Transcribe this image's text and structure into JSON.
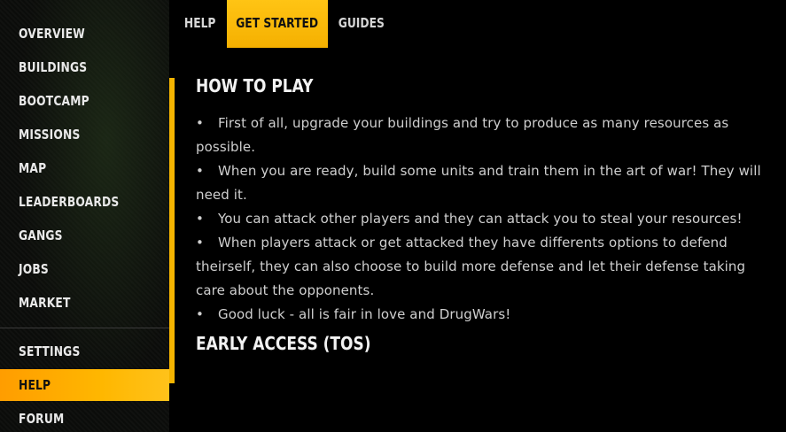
{
  "sidebar": {
    "items": [
      {
        "label": "OVERVIEW"
      },
      {
        "label": "BUILDINGS"
      },
      {
        "label": "BOOTCAMP"
      },
      {
        "label": "MISSIONS"
      },
      {
        "label": "MAP"
      },
      {
        "label": "LEADERBOARDS"
      },
      {
        "label": "GANGS"
      },
      {
        "label": "JOBS"
      },
      {
        "label": "MARKET"
      },
      {
        "label": "SETTINGS"
      },
      {
        "label": "HELP"
      },
      {
        "label": "FORUM"
      }
    ],
    "active_item": "HELP"
  },
  "tabs": {
    "items": [
      {
        "label": "HELP"
      },
      {
        "label": "GET STARTED"
      },
      {
        "label": "GUIDES"
      }
    ],
    "active_tab": "GET STARTED"
  },
  "content": {
    "how_to_play": {
      "title": "HOW TO PLAY",
      "bullets": [
        "First of all, upgrade your buildings and try to produce as many resources as possible.",
        "When you are ready, build some units and train them in the art of war! They will need it.",
        "You can attack other players and they can attack you to steal your resources!",
        "When players attack or get attacked they have differents options to defend theirself, they can also choose to build more defense and let their defense taking care about the opponents.",
        "Good luck - all is fair in love and DrugWars!"
      ]
    },
    "early_access": {
      "title": "EARLY ACCESS (TOS)"
    }
  },
  "colors": {
    "accent": "#FFB700",
    "background": "#000000",
    "text": "#CFCFCF"
  }
}
